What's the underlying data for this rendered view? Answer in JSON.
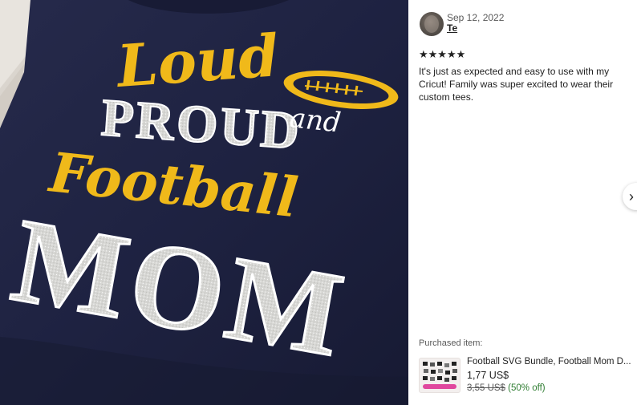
{
  "photo": {
    "description_colors": {
      "shirt": "#1e2140",
      "gold": "#f0b91a",
      "silver": "#d9d9d6"
    },
    "text_lines": [
      "Loud",
      "and",
      "PROUD",
      "Football",
      "MOM"
    ]
  },
  "review": {
    "date": "Sep 12, 2022",
    "username": "Te",
    "stars": "★★★★★",
    "text": "It's just as expected and easy to use with my Cricut! Family was super excited to wear their custom tees."
  },
  "nav": {
    "next_icon": "›"
  },
  "purchase": {
    "label": "Purchased item:",
    "title": "Football SVG Bundle, Football Mom D...",
    "price": "1,77 US$",
    "original_price": "3,55 US$",
    "discount": "(50% off)"
  },
  "colors": {
    "discount_green": "#2f7d32",
    "star": "#222222"
  }
}
